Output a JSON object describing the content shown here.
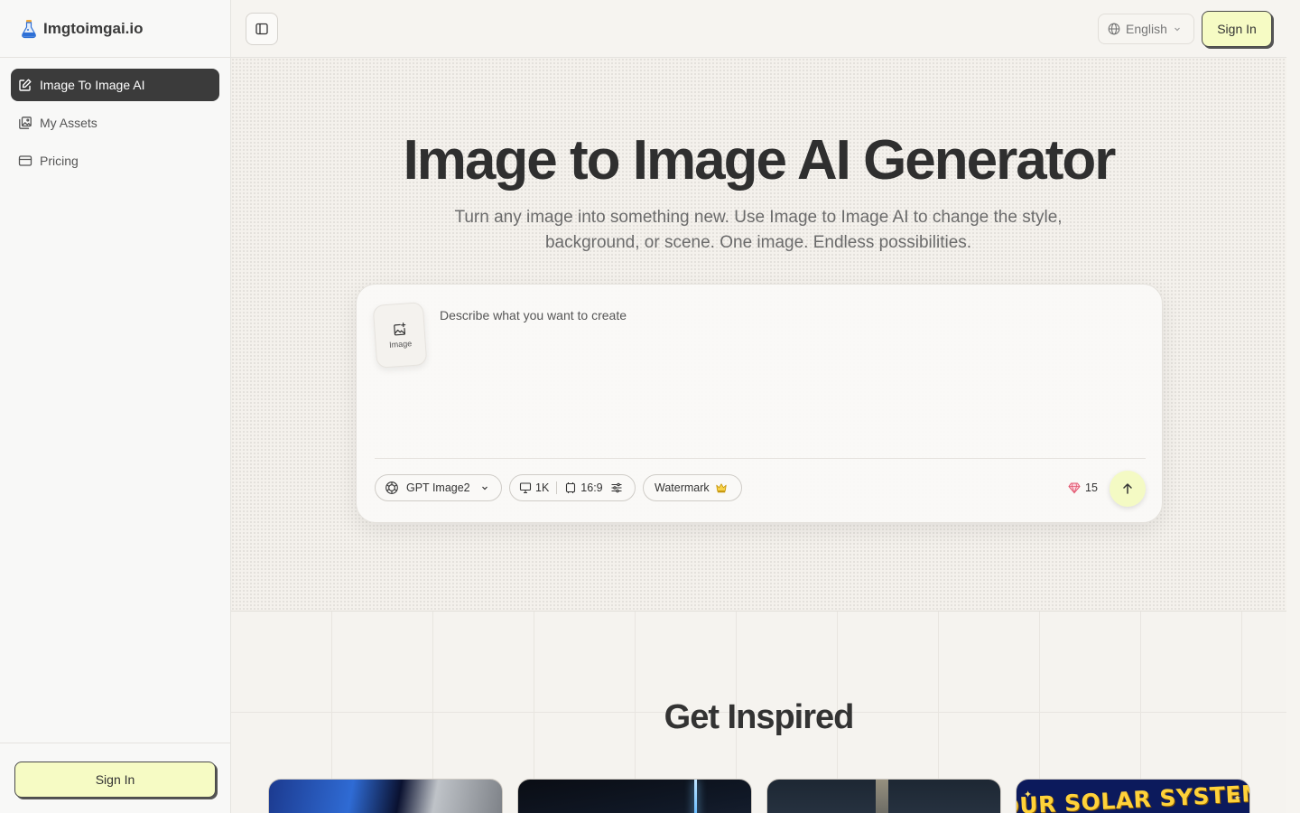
{
  "brand": {
    "name": "Imgtoimgai.io"
  },
  "sidebar": {
    "items": [
      {
        "label": "Image To Image AI",
        "icon": "edit-icon",
        "active": true
      },
      {
        "label": "My Assets",
        "icon": "gallery-icon",
        "active": false
      },
      {
        "label": "Pricing",
        "icon": "credit-card-icon",
        "active": false
      }
    ],
    "signin_label": "Sign In"
  },
  "header": {
    "language": "English",
    "signin_label": "Sign In"
  },
  "hero": {
    "title": "Image to Image AI Generator",
    "subtitle": "Turn any image into something new. Use Image to Image AI to change the style, background, or scene. One image. Endless possibilities."
  },
  "prompt": {
    "upload_label": "Image",
    "placeholder": "Describe what you want to create",
    "value": "",
    "model": "GPT Image2",
    "resolution": "1K",
    "aspect_ratio": "16:9",
    "watermark_label": "Watermark",
    "credits": "15"
  },
  "inspire": {
    "title": "Get Inspired",
    "cards": [
      {
        "text": ""
      },
      {
        "text": ""
      },
      {
        "text": ""
      },
      {
        "text": "OUR SOLAR SYSTEM"
      }
    ]
  },
  "colors": {
    "accent_yellow": "#f6fbc4",
    "active_nav": "#3b3b3b",
    "background": "#f6f4f0"
  }
}
